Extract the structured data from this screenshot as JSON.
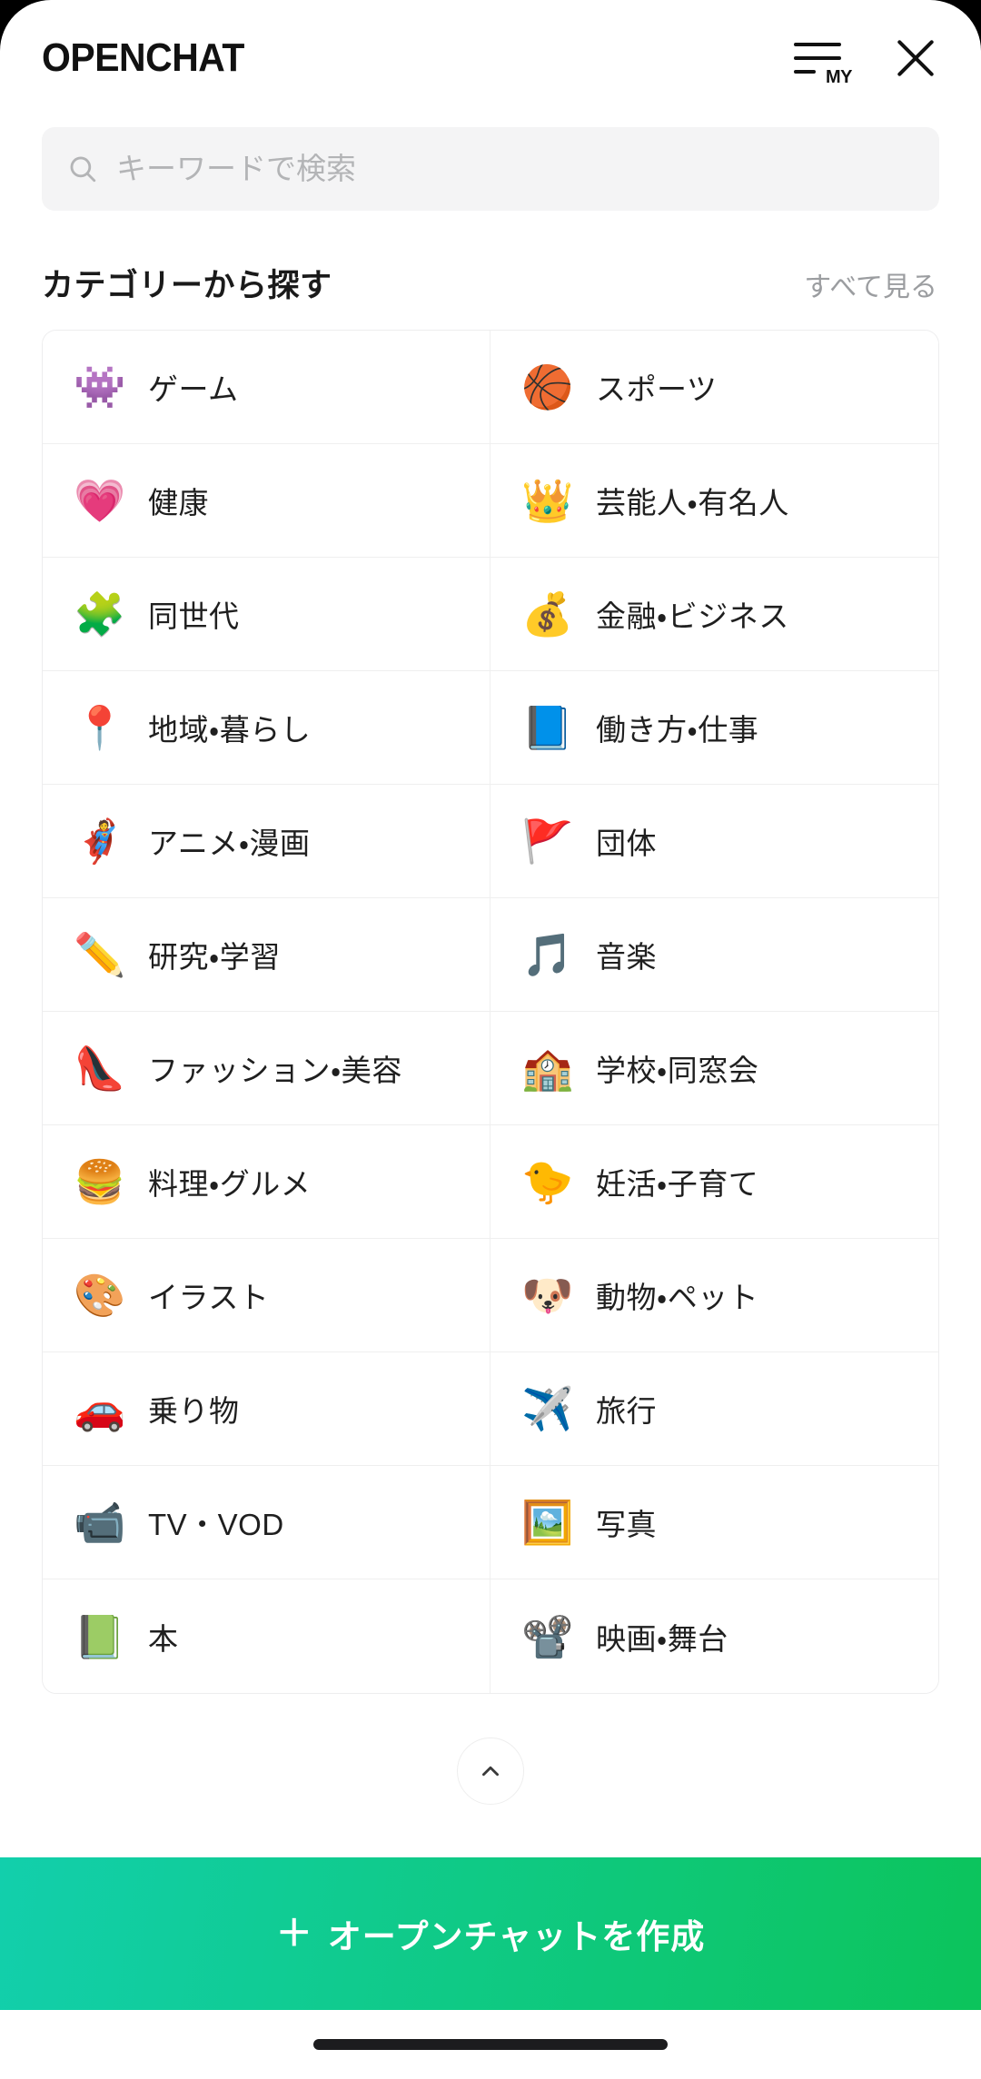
{
  "header": {
    "brand": "OPENCHAT",
    "my_menu_label": "MY",
    "menu_icon": "hamburger-my-icon",
    "close_icon": "close-icon"
  },
  "search": {
    "icon": "search-icon",
    "placeholder": "キーワードで検索",
    "value": ""
  },
  "section": {
    "title": "カテゴリーから探す",
    "see_all": "すべて見る"
  },
  "categories": [
    {
      "emoji": "👾",
      "icon": "ghost-icon",
      "label": "ゲーム"
    },
    {
      "emoji": "🏀",
      "icon": "basketball-icon",
      "label": "スポーツ"
    },
    {
      "emoji": "💗",
      "icon": "heartbeat-icon",
      "label": "健康"
    },
    {
      "emoji": "👑",
      "icon": "crown-icon",
      "label": "芸能人・有名人"
    },
    {
      "emoji": "🧩",
      "icon": "puzzle-icon",
      "label": "同世代"
    },
    {
      "emoji": "💰",
      "icon": "coin-dollar-icon",
      "label": "金融・ビジネス"
    },
    {
      "emoji": "📍",
      "icon": "map-pin-icon",
      "label": "地域・暮らし"
    },
    {
      "emoji": "📘",
      "icon": "work-document-icon",
      "label": "働き方・仕事"
    },
    {
      "emoji": "🦸",
      "icon": "hero-mask-icon",
      "label": "アニメ・漫画"
    },
    {
      "emoji": "🚩",
      "icon": "red-flag-icon",
      "label": "団体"
    },
    {
      "emoji": "✏️",
      "icon": "pencil-icon",
      "label": "研究・学習"
    },
    {
      "emoji": "🎵",
      "icon": "music-note-icon",
      "label": "音楽"
    },
    {
      "emoji": "👠",
      "icon": "high-heel-icon",
      "label": "ファッション・美容"
    },
    {
      "emoji": "🏫",
      "icon": "school-icon",
      "label": "学校・同窓会"
    },
    {
      "emoji": "🍔",
      "icon": "hamburger-food-icon",
      "label": "料理・グルメ"
    },
    {
      "emoji": "🐤",
      "icon": "duck-icon",
      "label": "妊活・子育て"
    },
    {
      "emoji": "🎨",
      "icon": "palette-icon",
      "label": "イラスト"
    },
    {
      "emoji": "🐶",
      "icon": "dog-icon",
      "label": "動物・ペット"
    },
    {
      "emoji": "🚗",
      "icon": "car-icon",
      "label": "乗り物"
    },
    {
      "emoji": "✈️",
      "icon": "airplane-icon",
      "label": "旅行"
    },
    {
      "emoji": "📹",
      "icon": "video-camera-icon",
      "label": "TV・VOD"
    },
    {
      "emoji": "🖼️",
      "icon": "photo-icon",
      "label": "写真"
    },
    {
      "emoji": "📗",
      "icon": "book-icon",
      "label": "本"
    },
    {
      "emoji": "📽️",
      "icon": "film-projector-icon",
      "label": "映画・舞台"
    }
  ],
  "collapse": {
    "icon": "chevron-up-icon"
  },
  "cta": {
    "plus": "＋",
    "label": "オープンチャットを作成",
    "gradient_start": "#12cfac",
    "gradient_end": "#0cc45b"
  }
}
